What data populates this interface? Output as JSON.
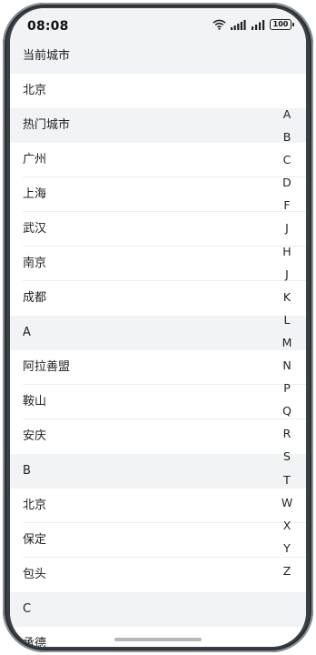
{
  "status_bar": {
    "time": "08:08",
    "battery": "100",
    "icons": [
      "wifi-icon",
      "signal-icon",
      "signal-icon",
      "battery-icon"
    ]
  },
  "list": [
    {
      "type": "header",
      "label": "当前城市"
    },
    {
      "type": "item",
      "label": "北京"
    },
    {
      "type": "header",
      "label": "热门城市"
    },
    {
      "type": "item",
      "label": "广州"
    },
    {
      "type": "item",
      "label": "上海"
    },
    {
      "type": "item",
      "label": "武汉"
    },
    {
      "type": "item",
      "label": "南京"
    },
    {
      "type": "item",
      "label": "成都"
    },
    {
      "type": "header",
      "label": "A"
    },
    {
      "type": "item",
      "label": "阿拉善盟"
    },
    {
      "type": "item",
      "label": "鞍山"
    },
    {
      "type": "item",
      "label": "安庆"
    },
    {
      "type": "header",
      "label": "B"
    },
    {
      "type": "item",
      "label": "北京"
    },
    {
      "type": "item",
      "label": "保定"
    },
    {
      "type": "item",
      "label": "包头"
    },
    {
      "type": "header",
      "label": "C"
    },
    {
      "type": "item",
      "label": "承德"
    }
  ],
  "index_bar": [
    "A",
    "B",
    "C",
    "D",
    "F",
    "J",
    "H",
    "J",
    "K",
    "L",
    "M",
    "N",
    "P",
    "Q",
    "R",
    "S",
    "T",
    "W",
    "X",
    "Y",
    "Z"
  ]
}
